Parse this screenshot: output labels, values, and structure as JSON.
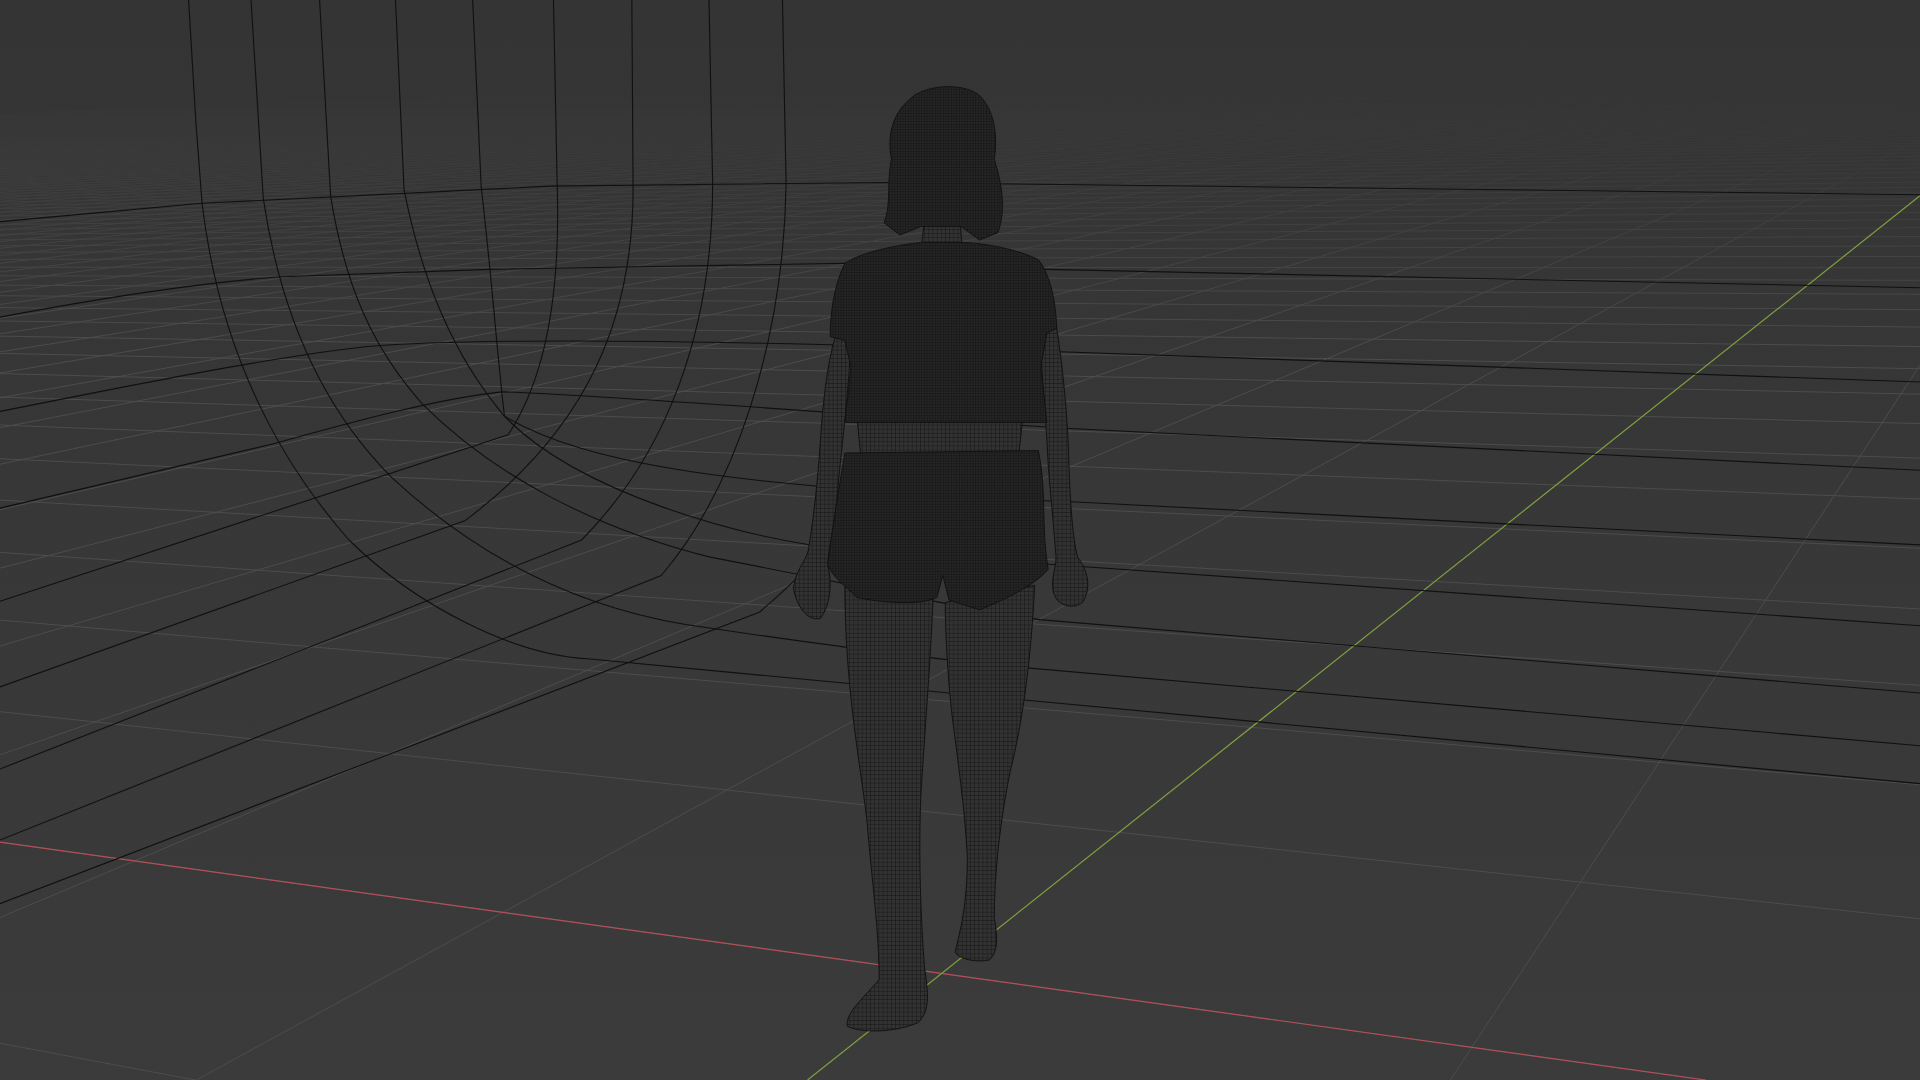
{
  "viewport": {
    "layers": [
      {
        "kind": "grid"
      },
      {
        "kind": "axes",
        "lines": [
          {
            "kind": "x",
            "color": "#b34f58"
          },
          {
            "kind": "y",
            "color": "#7c9f3d"
          }
        ]
      },
      {
        "kind": "backdrop"
      },
      {
        "kind": "figure"
      }
    ]
  }
}
